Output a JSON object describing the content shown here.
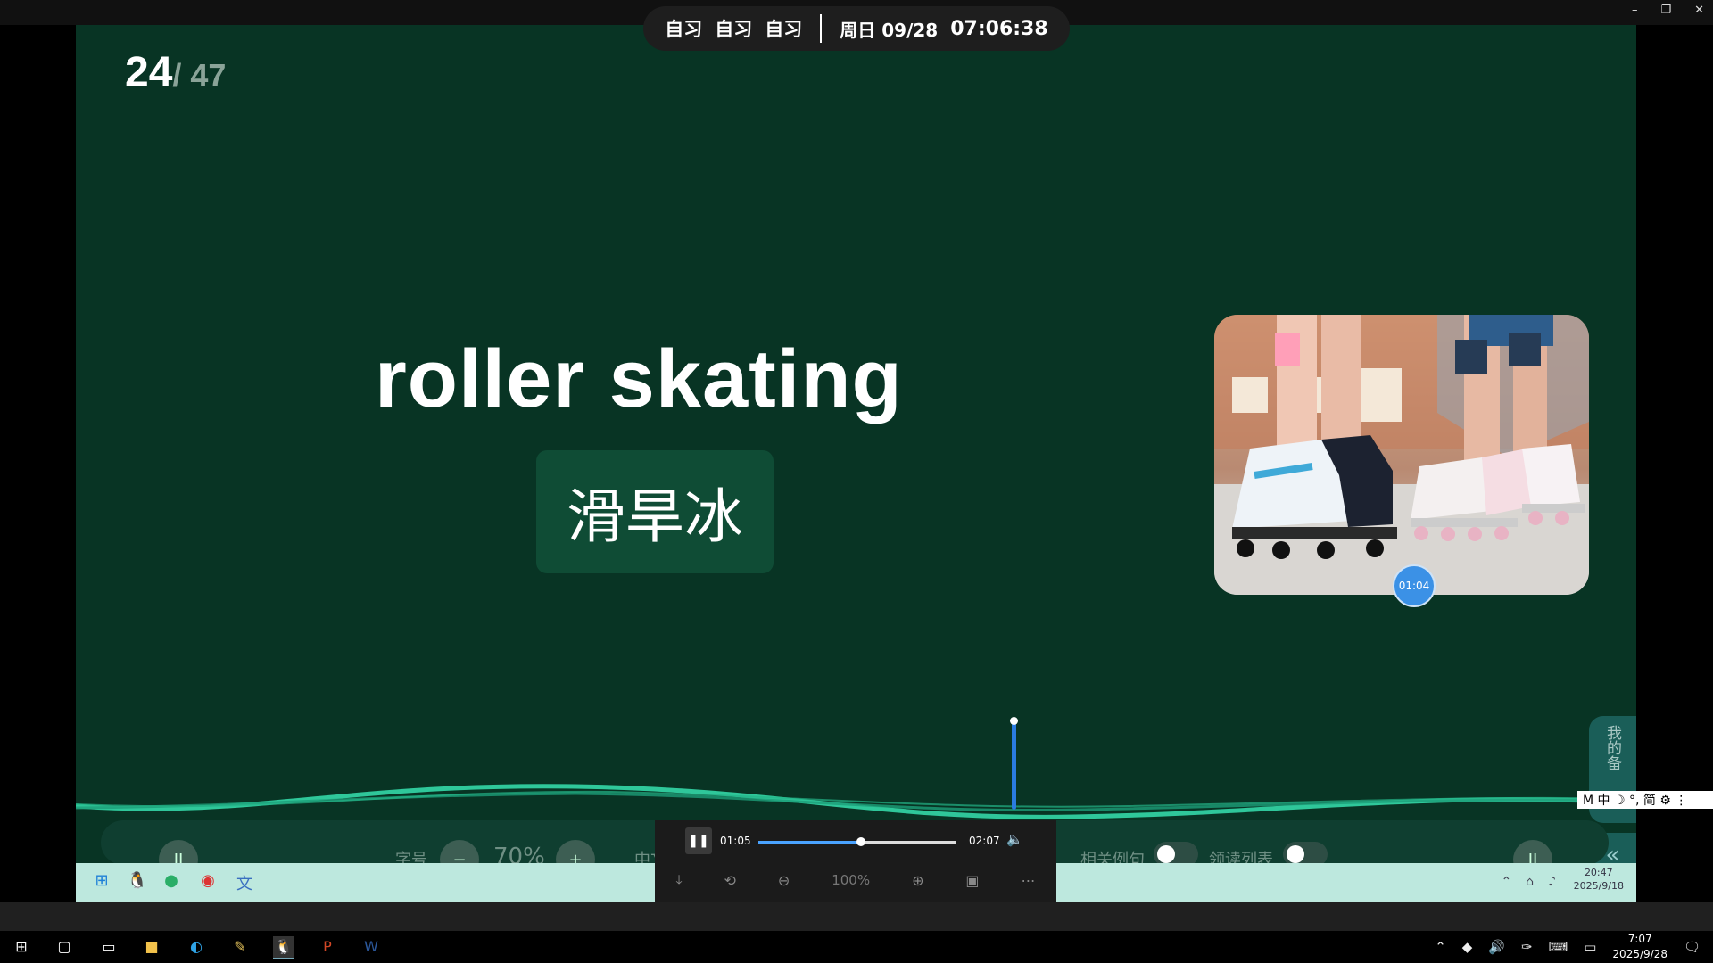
{
  "top_pill": {
    "session1": "自习",
    "session2": "自习",
    "session3": "自习",
    "date": "周日 09/28",
    "time": "07:06:38"
  },
  "window_controls": {
    "minimize": "–",
    "restore": "❐",
    "close": "✕"
  },
  "slide": {
    "page_current": "24",
    "page_total": "/ 47",
    "word": "roller skating",
    "meaning": "滑旱冰",
    "photo_timer": "01:04",
    "side_panel_label": "我的备",
    "collapse_icon": "«"
  },
  "ime_bar": "M 中 ☽ °, 简 ⚙ ⋮",
  "bottom_bar": {
    "font_size_label": "字号",
    "font_minus": "−",
    "font_value": "70%",
    "font_plus": "+",
    "lang_label": "中文",
    "examples_label": "相关例句",
    "reading_list_label": "领读列表",
    "pause_icon": "II"
  },
  "media_player": {
    "current_time": "01:05",
    "total_time": "02:07",
    "progress": 0.52,
    "zoom": "100%"
  },
  "inner_taskbar": {
    "time": "20:47",
    "date": "2025/9/18"
  },
  "taskbar": {
    "time": "7:07",
    "date": "2025/9/28"
  },
  "colors": {
    "slide_bg": "#083424",
    "wave": "#2fc79a",
    "accent": "#3b91e6"
  }
}
